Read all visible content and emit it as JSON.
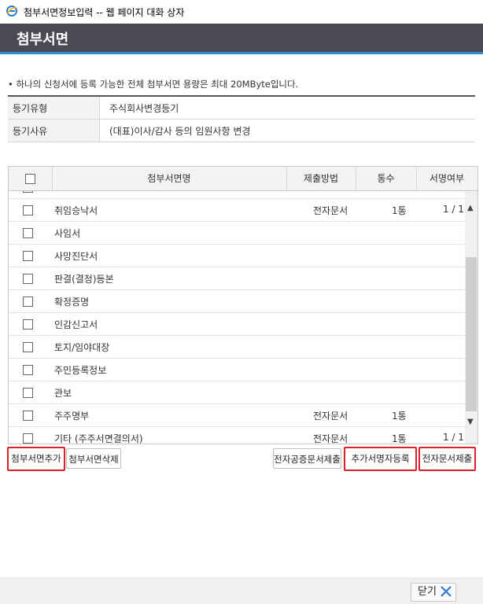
{
  "window": {
    "title": "첨부서면정보입력 -- 웹 페이지 대화 상자"
  },
  "header": {
    "title": "첨부서면"
  },
  "notice": "• 하나의 신청서에 등록 가능한 전체 첨부서면 용량은 최대 20MByte입니다.",
  "info": {
    "type_label": "등기유형",
    "type_value": "주식회사변경등기",
    "reason_label": "등기사유",
    "reason_value": "(대표)이사/감사 등의 임원사항 변경"
  },
  "grid": {
    "columns": {
      "name": "첨부서면명",
      "method": "제출방법",
      "count": "통수",
      "sign": "서명여부"
    },
    "rows": [
      {
        "name": "취임승낙서",
        "method": "전자문서",
        "count": "1통",
        "sign": "1 / 1"
      },
      {
        "name": "사임서",
        "method": "",
        "count": "",
        "sign": ""
      },
      {
        "name": "사망진단서",
        "method": "",
        "count": "",
        "sign": ""
      },
      {
        "name": "판결(결정)등본",
        "method": "",
        "count": "",
        "sign": ""
      },
      {
        "name": "확정증명",
        "method": "",
        "count": "",
        "sign": ""
      },
      {
        "name": "인감신고서",
        "method": "",
        "count": "",
        "sign": ""
      },
      {
        "name": "토지/임야대장",
        "method": "",
        "count": "",
        "sign": ""
      },
      {
        "name": "주민등록정보",
        "method": "",
        "count": "",
        "sign": ""
      },
      {
        "name": "관보",
        "method": "",
        "count": "",
        "sign": ""
      },
      {
        "name": "주주명부",
        "method": "전자문서",
        "count": "1통",
        "sign": ""
      },
      {
        "name": "기타 (주주서면결의서)",
        "method": "전자문서",
        "count": "1통",
        "sign": "1 / 1"
      }
    ]
  },
  "buttons": {
    "add": "첨부서면추가",
    "delete": "첨부서면삭제",
    "notary": "전자공증문서제출",
    "add_signer": "추가서명자등록",
    "submit": "전자문서제출"
  },
  "footer": {
    "close_label": "닫기"
  },
  "colors": {
    "header_bg": "#4a4a55",
    "accent": "#2c8fd6",
    "highlight": "#d9222a"
  }
}
